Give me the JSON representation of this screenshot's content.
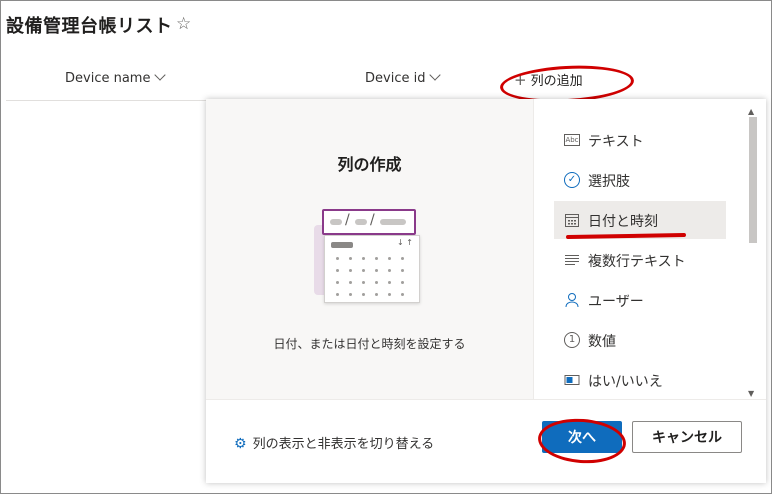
{
  "page": {
    "title": "設備管理台帳リスト",
    "favorite_icon": "star-icon"
  },
  "columns": {
    "device_name": "Device name",
    "device_id": "Device id",
    "add_column": "列の追加"
  },
  "panel": {
    "title": "列の作成",
    "description": "日付、または日付と時刻を設定する",
    "types": [
      {
        "label": "テキスト",
        "icon": "text-icon"
      },
      {
        "label": "選択肢",
        "icon": "choice-check-icon"
      },
      {
        "label": "日付と時刻",
        "icon": "calendar-icon",
        "selected": true
      },
      {
        "label": "複数行テキスト",
        "icon": "multiline-text-icon"
      },
      {
        "label": "ユーザー",
        "icon": "person-icon"
      },
      {
        "label": "数値",
        "icon": "number-icon"
      },
      {
        "label": "はい/いいえ",
        "icon": "yes-no-toggle-icon"
      }
    ],
    "toggle_columns_link": "列の表示と非表示を切り替える",
    "next_button": "次へ",
    "cancel_button": "キャンセル"
  },
  "colors": {
    "accent": "#0f6cbd",
    "annotation": "#d00000",
    "illustration_accent": "#8a3a8a"
  }
}
